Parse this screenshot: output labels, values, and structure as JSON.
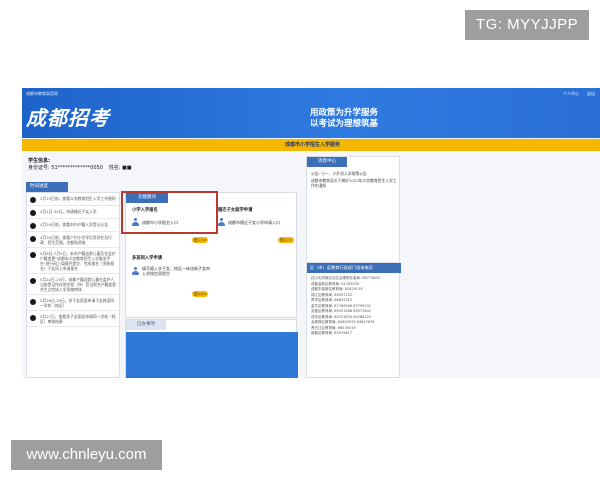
{
  "overlay": {
    "tg_badge": "TG: MYYJJPP",
    "watermark": "www.chnleyu.com"
  },
  "banner": {
    "top_left": "成都市教育局官网",
    "links": [
      "个人中心",
      "退出"
    ],
    "logo": "成都招考",
    "slogan_line1": "用政策为升学服务",
    "slogan_line2": "以考试为理想筑基"
  },
  "stripe_title": "成都市小学招生入学服务",
  "student": {
    "label": "学生信息:",
    "id_label": "身份证号: 51*************0050",
    "name_label": "姓名: ■■"
  },
  "timeline": {
    "title": "时间进度",
    "items": [
      "3月15日前，查看义务教育招生入学工作细则",
      "4月1日-30日，申请随迁子女入学",
      "4月20日前，查看市内户籍入学登记公告",
      "4月30日前，查看户内小学学位类别任及行政、招生范围，名额和资格",
      "5月6日-7月5日，本市户籍适龄儿童及在监护户籍变更“成都市义务教育招生入学服务平台”进行网上填报并提交、完成报名（多胎报名）子女同上申请报名",
      "5月22日-25日，成都户籍适龄儿童在监护人当前登记所在地学校（所）登记报名户籍变更并生过完成入学资格审核",
      "5月26日-25日，多子女家庭申请子女就读同一学校（校区）",
      "5月27日，查看多子女家庭申请同一学校（校区）审核结果"
    ]
  },
  "func_panel": {
    "tab": "功能模块",
    "cards": [
      {
        "title": "小学入学报名",
        "entry": "成都市小学报名入口",
        "button": "进入>>"
      },
      {
        "title": "随迁子女就学申请",
        "entry": "成都市随迁子女小学申请入口",
        "button": "进入>>"
      },
      {
        "title": "多孩同入学申请",
        "entry": "填写随入学子女、校区一体化新子女申入学校信息提交",
        "button": "进入>>"
      }
    ]
  },
  "done_panel": {
    "tab": "已办事项"
  },
  "messages": {
    "title": "消息中心",
    "items": [
      "公告: 小一、小升初入学政策公告",
      "成都市教育局关于做好2023年义务教育招生入学工作的通知"
    ]
  },
  "phones": {
    "title": "区（市）县教育行政部门咨询电话",
    "items": [
      "四川天府新区社区治理和社事局: 68773632",
      "成都高新区教育局: 61335535",
      "成都东部新区教育局: 82829115",
      "锦江区教育局: 84557152",
      "青羊区教育局: 86632315",
      "金牛区教育局: 87769596 87799232",
      "武侯区教育局: 85551588 85077642",
      "成华区教育局: 84321830 84368120",
      "龙泉驿区教育局: 84805939 84847876",
      "青白江区教育局: 66535519",
      "新都区教育局: 83979817"
    ]
  }
}
